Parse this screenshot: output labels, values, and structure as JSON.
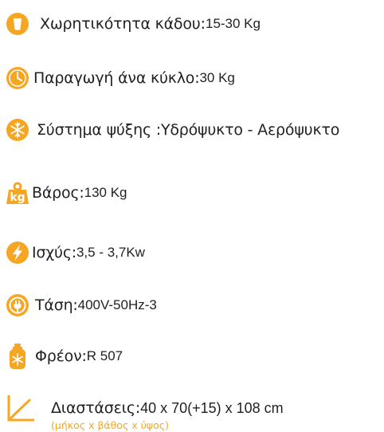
{
  "colors": {
    "accent": "#f5a623",
    "text": "#231f20"
  },
  "specs": [
    {
      "icon": "bin-icon",
      "label": "Χωρητικότητα κάδου",
      "sep": " : ",
      "value": "15-30 Kg"
    },
    {
      "icon": "clock-icon",
      "label": "Παραγωγή άνα κύκλο:",
      "sep": " ",
      "value": "30 Kg"
    },
    {
      "icon": "snowflake-icon",
      "label": "Σύστημα ψύξης :",
      "sep": "",
      "value": "Υδρόψυκτο - Αερόψυκτο"
    },
    {
      "icon": "weight-icon",
      "icon_text": "kg",
      "label": "Βάρος:",
      "sep": " ",
      "value": "130 Kg"
    },
    {
      "icon": "lightning-icon",
      "label": "Ισχύς:",
      "sep": " ",
      "value": "3,5 - 3,7Kw"
    },
    {
      "icon": "plug-icon",
      "label": "Τάση:",
      "sep": " ",
      "value": "400V-50Hz-3"
    },
    {
      "icon": "freon-tank-icon",
      "label": "Φρέον:",
      "sep": " ",
      "value": "R 507"
    },
    {
      "icon": "dimensions-icon",
      "label": "Διαστάσεις:",
      "sep": " ",
      "value": "40 x 70(+15) x 108 cm",
      "note": "(μήκος x βάθος x ύψος)"
    }
  ]
}
